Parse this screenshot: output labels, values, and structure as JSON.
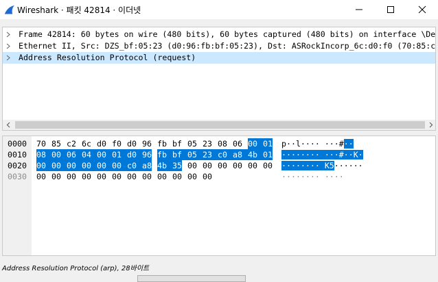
{
  "window": {
    "title": "Wireshark · 패킷 42814 · 이더넷",
    "accent": "#1e6bd6"
  },
  "tree": [
    {
      "label": "Frame 42814: 60 bytes on wire (480 bits), 60 bytes captured (480 bits) on interface \\De",
      "selected": false
    },
    {
      "label": "Ethernet II, Src: DZS_bf:05:23 (d0:96:fb:bf:05:23), Dst: ASRockIncorp_6c:d0:f0 (70:85:c",
      "selected": false
    },
    {
      "label": "Address Resolution Protocol (request)",
      "selected": true
    }
  ],
  "hex": {
    "highlight_color": "#0078d7",
    "rows": [
      {
        "offset": "0000",
        "dim": false,
        "bytes": [
          "70",
          "85",
          "c2",
          "6c",
          "d0",
          "f0",
          "d0",
          "96",
          "fb",
          "bf",
          "05",
          "23",
          "08",
          "06",
          "00",
          "01"
        ],
        "hl_start": 14,
        "hl_end": 16,
        "ascii_plain": "p··l···· ···#",
        "ascii_hl": "··"
      },
      {
        "offset": "0010",
        "dim": false,
        "bytes": [
          "08",
          "00",
          "06",
          "04",
          "00",
          "01",
          "d0",
          "96",
          "fb",
          "bf",
          "05",
          "23",
          "c0",
          "a8",
          "4b",
          "01"
        ],
        "hl_start": 0,
        "hl_end": 16,
        "ascii_plain": "",
        "ascii_hl": "········ ···#··K·"
      },
      {
        "offset": "0020",
        "dim": false,
        "bytes": [
          "00",
          "00",
          "00",
          "00",
          "00",
          "00",
          "c0",
          "a8",
          "4b",
          "35",
          "00",
          "00",
          "00",
          "00",
          "00",
          "00"
        ],
        "hl_start": 0,
        "hl_end": 10,
        "ascii_plain": "······",
        "ascii_hl": "········ K5"
      },
      {
        "offset": "0030",
        "dim": true,
        "bytes": [
          "00",
          "00",
          "00",
          "00",
          "00",
          "00",
          "00",
          "00",
          "00",
          "00",
          "00",
          "00"
        ],
        "hl_start": 0,
        "hl_end": 0,
        "ascii_plain": "········ ····",
        "ascii_hl": ""
      }
    ]
  },
  "status": {
    "text": "Address Resolution Protocol (arp), 28바이트"
  }
}
